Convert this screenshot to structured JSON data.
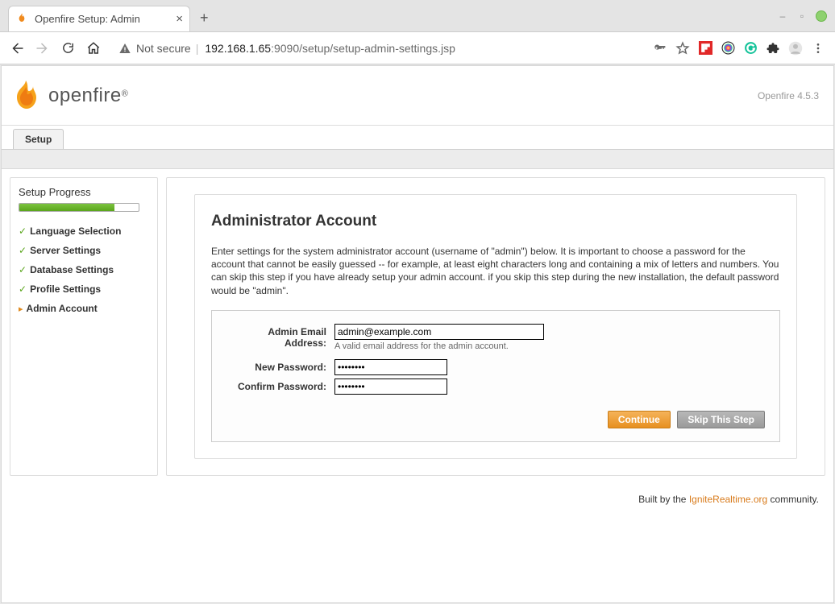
{
  "window": {
    "tab_title": "Openfire Setup: Admin",
    "url_host": "192.168.1.65",
    "url_port": ":9090",
    "url_path": "/setup/setup-admin-settings.jsp",
    "not_secure_label": "Not secure"
  },
  "brand": {
    "name": "openfire",
    "version": "Openfire 4.5.3"
  },
  "tabs": {
    "setup": "Setup"
  },
  "sidebar": {
    "title": "Setup Progress",
    "progress_pct": 80,
    "steps": [
      {
        "label": "Language Selection"
      },
      {
        "label": "Server Settings"
      },
      {
        "label": "Database Settings"
      },
      {
        "label": "Profile Settings"
      },
      {
        "label": "Admin Account"
      }
    ]
  },
  "page": {
    "title": "Administrator Account",
    "desc": "Enter settings for the system administrator account (username of \"admin\") below. It is important to choose a password for the account that cannot be easily guessed -- for example, at least eight characters long and containing a mix of letters and numbers. You can skip this step if you have already setup your admin account. if you skip this step during the new installation, the default password would be \"admin\".",
    "labels": {
      "email": "Admin Email Address:",
      "new_pw": "New Password:",
      "confirm_pw": "Confirm Password:"
    },
    "values": {
      "email": "admin@example.com",
      "new_pw": "••••••••",
      "confirm_pw": "••••••••"
    },
    "hints": {
      "email": "A valid email address for the admin account."
    },
    "buttons": {
      "continue": "Continue",
      "skip": "Skip This Step"
    }
  },
  "footer": {
    "built_by": "Built by the ",
    "link_text": "IgniteRealtime.org",
    "community": " community."
  }
}
